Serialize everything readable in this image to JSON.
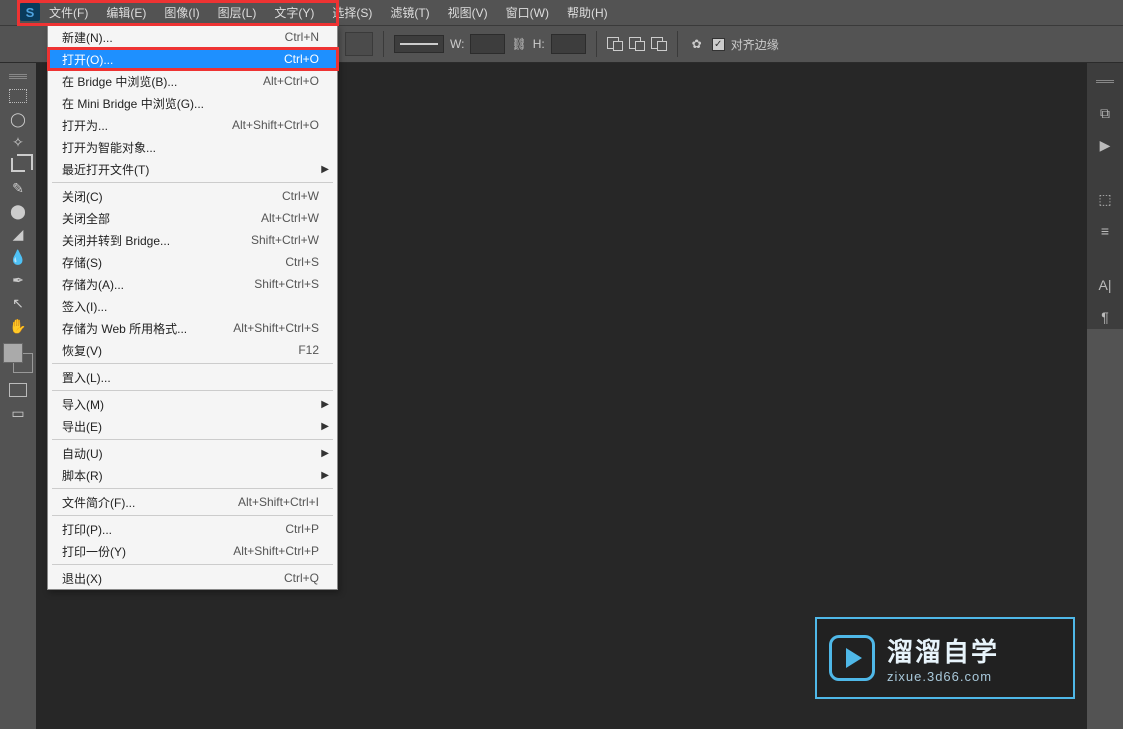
{
  "app_logo": "S",
  "menubar": {
    "items": [
      "文件(F)",
      "编辑(E)",
      "图像(I)",
      "图层(L)",
      "文字(Y)",
      "选择(S)",
      "滤镜(T)",
      "视图(V)",
      "窗口(W)",
      "帮助(H)"
    ]
  },
  "optionbar": {
    "w_label": "W:",
    "h_label": "H:",
    "link_icon": "⛓",
    "gear_icon": "✿",
    "align_checkbox_checked": "✓",
    "align_label": "对齐边缘"
  },
  "dropdown": {
    "groups": [
      [
        {
          "label": "新建(N)...",
          "shortcut": "Ctrl+N"
        },
        {
          "label": "打开(O)...",
          "shortcut": "Ctrl+O",
          "highlight": true
        },
        {
          "label": "在 Bridge 中浏览(B)...",
          "shortcut": "Alt+Ctrl+O"
        },
        {
          "label": "在 Mini Bridge 中浏览(G)...",
          "shortcut": ""
        },
        {
          "label": "打开为...",
          "shortcut": "Alt+Shift+Ctrl+O"
        },
        {
          "label": "打开为智能对象...",
          "shortcut": ""
        },
        {
          "label": "最近打开文件(T)",
          "shortcut": "",
          "submenu": true
        }
      ],
      [
        {
          "label": "关闭(C)",
          "shortcut": "Ctrl+W"
        },
        {
          "label": "关闭全部",
          "shortcut": "Alt+Ctrl+W"
        },
        {
          "label": "关闭并转到 Bridge...",
          "shortcut": "Shift+Ctrl+W"
        },
        {
          "label": "存储(S)",
          "shortcut": "Ctrl+S"
        },
        {
          "label": "存储为(A)...",
          "shortcut": "Shift+Ctrl+S"
        },
        {
          "label": "签入(I)...",
          "shortcut": ""
        },
        {
          "label": "存储为 Web 所用格式...",
          "shortcut": "Alt+Shift+Ctrl+S"
        },
        {
          "label": "恢复(V)",
          "shortcut": "F12"
        }
      ],
      [
        {
          "label": "置入(L)...",
          "shortcut": ""
        }
      ],
      [
        {
          "label": "导入(M)",
          "shortcut": "",
          "submenu": true
        },
        {
          "label": "导出(E)",
          "shortcut": "",
          "submenu": true
        }
      ],
      [
        {
          "label": "自动(U)",
          "shortcut": "",
          "submenu": true
        },
        {
          "label": "脚本(R)",
          "shortcut": "",
          "submenu": true
        }
      ],
      [
        {
          "label": "文件简介(F)...",
          "shortcut": "Alt+Shift+Ctrl+I"
        }
      ],
      [
        {
          "label": "打印(P)...",
          "shortcut": "Ctrl+P"
        },
        {
          "label": "打印一份(Y)",
          "shortcut": "Alt+Shift+Ctrl+P"
        }
      ],
      [
        {
          "label": "退出(X)",
          "shortcut": "Ctrl+Q"
        }
      ]
    ]
  },
  "watermark": {
    "title": "溜溜自学",
    "url": "zixue.3d66.com"
  },
  "tools": [
    "▭",
    "○",
    "◯",
    "✂",
    "⚲",
    "🖌",
    "▭",
    "◆",
    "💧",
    "✎",
    "↖",
    "✋"
  ],
  "right_icons": [
    "≣",
    "▶",
    "",
    "⧉",
    "≡",
    "",
    "A|",
    "¶"
  ]
}
